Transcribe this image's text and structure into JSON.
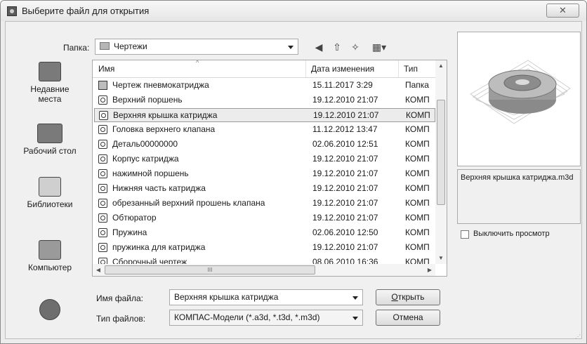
{
  "window": {
    "title": "Выберите файл для открытия",
    "close_symbol": "✕"
  },
  "folder": {
    "label": "Папка:",
    "value": "Чертежи"
  },
  "places": [
    {
      "label_line1": "Недавние",
      "label_line2": "места",
      "icon": "recent-places-icon"
    },
    {
      "label_line1": "Рабочий стол",
      "label_line2": "",
      "icon": "desktop-icon"
    },
    {
      "label_line1": "Библиотеки",
      "label_line2": "",
      "icon": "libraries-icon"
    },
    {
      "label_line1": "Компьютер",
      "label_line2": "",
      "icon": "computer-icon"
    },
    {
      "label_line1": "",
      "label_line2": "",
      "icon": "network-icon"
    }
  ],
  "list": {
    "columns": {
      "name": "Имя",
      "date": "Дата изменения",
      "type": "Тип"
    },
    "rows": [
      {
        "name": "Чертеж пневмокатриджа",
        "date": "15.11.2017 3:29",
        "type": "Папка",
        "icon": "folder-icon"
      },
      {
        "name": "Верхний поршень",
        "date": "19.12.2010 21:07",
        "type": "КОМП",
        "icon": "kompas-file-icon"
      },
      {
        "name": "Верхняя крышка катриджа",
        "date": "19.12.2010 21:07",
        "type": "КОМП",
        "icon": "kompas-file-icon"
      },
      {
        "name": "Головка верхнего клапана",
        "date": "11.12.2012 13:47",
        "type": "КОМП",
        "icon": "kompas-file-icon"
      },
      {
        "name": "Деталь00000000",
        "date": "02.06.2010 12:51",
        "type": "КОМП",
        "icon": "kompas-file-icon"
      },
      {
        "name": "Корпус катриджа",
        "date": "19.12.2010 21:07",
        "type": "КОМП",
        "icon": "kompas-file-icon"
      },
      {
        "name": "нажимной поршень",
        "date": "19.12.2010 21:07",
        "type": "КОМП",
        "icon": "kompas-file-icon"
      },
      {
        "name": "Нижняя часть катриджа",
        "date": "19.12.2010 21:07",
        "type": "КОМП",
        "icon": "kompas-file-icon"
      },
      {
        "name": "обрезанный верхний прошень клапана",
        "date": "19.12.2010 21:07",
        "type": "КОМП",
        "icon": "kompas-file-icon"
      },
      {
        "name": "Обтюратор",
        "date": "19.12.2010 21:07",
        "type": "КОМП",
        "icon": "kompas-file-icon"
      },
      {
        "name": "Пружина",
        "date": "02.06.2010 12:50",
        "type": "КОМП",
        "icon": "kompas-file-icon"
      },
      {
        "name": "пружинка для катриджа",
        "date": "19.12.2010 21:07",
        "type": "КОМП",
        "icon": "kompas-file-icon"
      },
      {
        "name": "Сборочный чертеж",
        "date": "08.06.2010 16:36",
        "type": "КОМП",
        "icon": "kompas-file-icon"
      }
    ],
    "selected_index": 2,
    "hscroll_grip": "III"
  },
  "filename": {
    "label": "Имя файла:",
    "value": "Верхняя крышка катриджа"
  },
  "filetype": {
    "label": "Тип файлов:",
    "value": "КОМПАС-Модели (*.a3d, *.t3d, *.m3d)"
  },
  "buttons": {
    "open_underlined": "О",
    "open_rest": "ткрыть",
    "cancel": "Отмена"
  },
  "preview": {
    "filename": "Верхняя крышка катриджа.m3d",
    "disable_label": "Выключить просмотр",
    "disable_checked": false
  }
}
